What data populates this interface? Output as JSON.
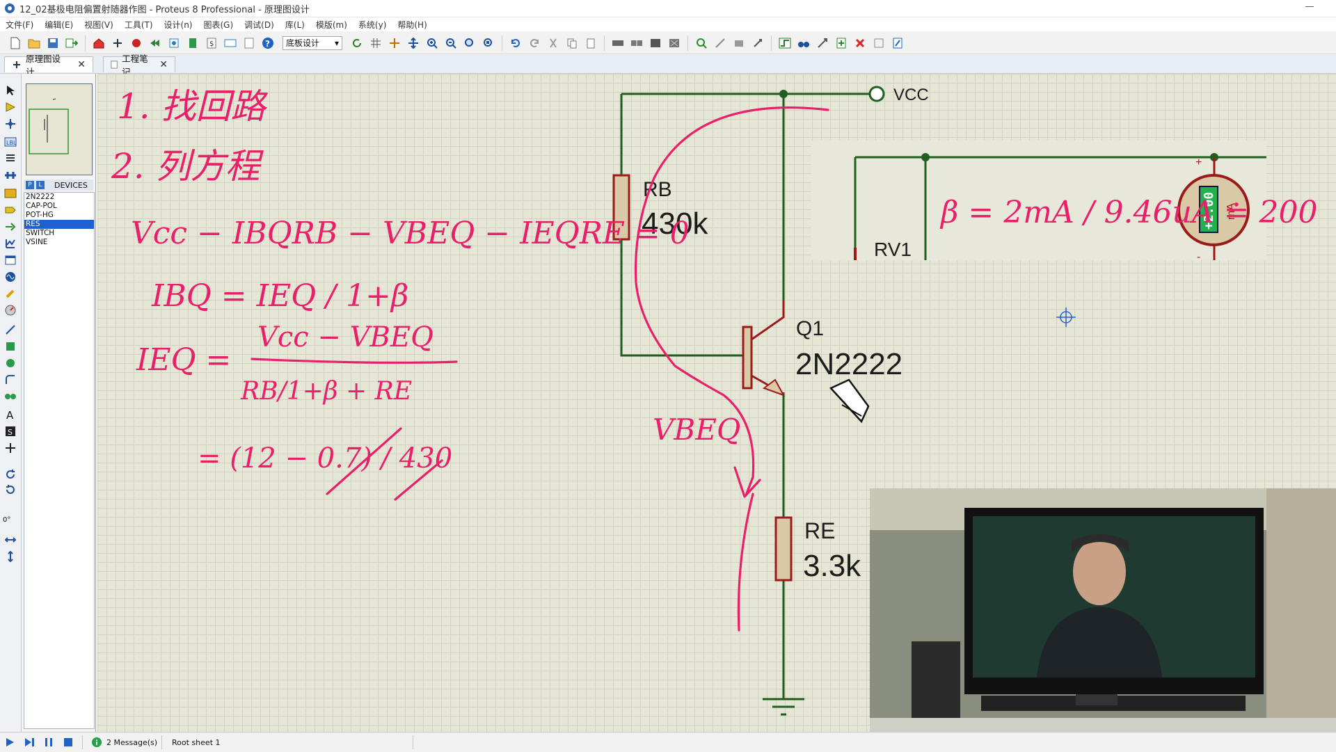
{
  "window": {
    "title": "12_02基极电阻偏置射随器作图 - Proteus 8 Professional - 原理图设计",
    "minimize": "—"
  },
  "menu": [
    "文件(F)",
    "编辑(E)",
    "视图(V)",
    "工具(T)",
    "设计(n)",
    "图表(G)",
    "调试(D)",
    "库(L)",
    "模版(m)",
    "系统(y)",
    "帮助(H)"
  ],
  "toolbar": {
    "layer_select": "底板设计"
  },
  "tabs": [
    {
      "label": "原理图设计",
      "active": true
    },
    {
      "label": "工程笔记",
      "active": false
    }
  ],
  "left_tools": {
    "rotation_value": "0°"
  },
  "devices": {
    "header_p": "P",
    "header_l": "L",
    "header_label": "DEVICES",
    "items": [
      "2N2222",
      "CAP-POL",
      "POT-HG",
      "RES",
      "SWITCH",
      "VSINE"
    ],
    "selected": "RES"
  },
  "schematic": {
    "vcc_label": "VCC",
    "rb_name": "RB",
    "rb_value": "430k",
    "q_name": "Q1",
    "q_part": "2N2222",
    "re_name": "RE",
    "re_value": "3.3k",
    "rv_name": "RV1",
    "ammeter_value": "+2.00",
    "ammeter_unit": "mA",
    "plus_sign": "+",
    "minus_sign": "-"
  },
  "annotations": {
    "step1": "1. 找回路",
    "step2": "2. 列方程",
    "eq_kvl": "Vcc − IBQRB − VBEQ − IEQRE = 0",
    "eq_ibq": "IBQ = IEQ / 1+β",
    "eq_ieq_lhs": "IEQ =",
    "eq_ieq_num": "Vcc − VBEQ",
    "eq_ieq_den": "RB/1+β + RE",
    "eq_calc": "= (12 − 0.7) / 430",
    "vbeq_label": "VBEQ",
    "beta_eq": "β = 2mA / 9.46uA ≐ 200"
  },
  "status": {
    "messages": "2 Message(s)",
    "sheet": "Root sheet 1"
  },
  "colors": {
    "wire": "#1f5f1f",
    "component": "#9b1b1b",
    "component_fill": "#d9c9a6",
    "annotation": "#e8206a",
    "canvas": "#e6e6d6",
    "ammeter_display": "#22b14c"
  }
}
